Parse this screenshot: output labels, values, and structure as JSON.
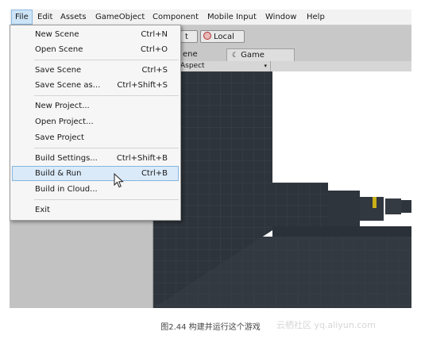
{
  "menubar": {
    "items": [
      "File",
      "Edit",
      "Assets",
      "GameObject",
      "Component",
      "Mobile Input",
      "Window",
      "Help"
    ]
  },
  "file_menu": {
    "items": [
      {
        "label": "New Scene",
        "shortcut": "Ctrl+N"
      },
      {
        "label": "Open Scene",
        "shortcut": "Ctrl+O"
      },
      {
        "label": "Save Scene",
        "shortcut": "Ctrl+S"
      },
      {
        "label": "Save Scene as...",
        "shortcut": "Ctrl+Shift+S"
      },
      {
        "label": "New Project...",
        "shortcut": ""
      },
      {
        "label": "Open Project...",
        "shortcut": ""
      },
      {
        "label": "Save Project",
        "shortcut": ""
      },
      {
        "label": "Build Settings...",
        "shortcut": "Ctrl+Shift+B"
      },
      {
        "label": "Build & Run",
        "shortcut": "Ctrl+B"
      },
      {
        "label": "Build in Cloud...",
        "shortcut": ""
      },
      {
        "label": "Exit",
        "shortcut": ""
      }
    ],
    "highlighted": "Build & Run"
  },
  "toolbar": {
    "pivot_partial": "t",
    "local_label": "Local"
  },
  "tabs": {
    "scene_partial": "ene",
    "game": "Game"
  },
  "game_toolbar": {
    "aspect": "Aspect"
  },
  "caption": "图2.44    构建并运行这个游戏",
  "watermark": "云栖社区 yq.aliyun.com",
  "colors": {
    "menu_highlight": "#dbeaf9",
    "menu_highlight_border": "#86b6e2",
    "sky": "#ffffff",
    "ground": "#2b3138"
  }
}
